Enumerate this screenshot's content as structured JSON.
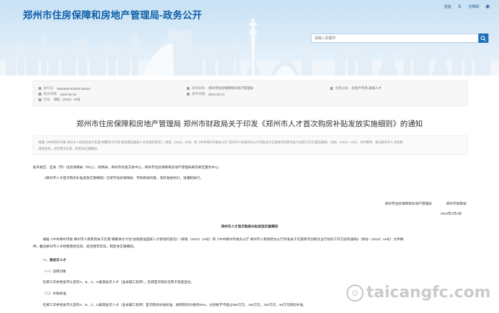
{
  "header": {
    "site_title": "郑州市住房保障和房地产管理局-政务公开",
    "links": [
      "智能",
      "无障碍"
    ],
    "search_placeholder": "请输入关键字"
  },
  "meta": {
    "row1": [
      {
        "label": "索引号:",
        "value": "0062929-6/2024-00019"
      },
      {
        "label": "发布机构:",
        "value": "郑州市住房保障和房地产管理局"
      },
      {
        "label": "主题分类:",
        "value": "房地产市场,高端人才"
      }
    ],
    "row2": [
      {
        "label": "成文日期:",
        "value": "2024-02-04"
      },
      {
        "label": "发布日期:",
        "value": "2024-02-21"
      }
    ],
    "row3": [
      {
        "label": "文号:",
        "value": "郑房〔2024〕23号"
      }
    ]
  },
  "doc_title": "郑州市住房保障和房地产管理局 郑州市财政局关于印发《郑州市人才首次购房补贴发放实施细则》的通知",
  "abstract": {
    "line1": "根据《中共郑州市委 郑州市人民政府关于实施“郑聚英才计划”加快建设国家人才高地的意见》（郑发〔2023〕19号）和《中共郑州市委办公厅 郑州市人民政府办公厅印发关于实施青年创新创业行动的工作方案的通知》（郑办〔2022〕18号）文件精神，推动郑州市人才政策",
    "line2": "落地见效，结合我市实际，制定本实施细则。"
  },
  "body": {
    "recipients": "各开发区、区县（市）住房保障局（中心），财政局，郑州市房屋交易中心，郑州市住房保障和房地产管理局郑东新区服务中心：",
    "intro": "《郑州市人才首次购房补贴发放实施细则》已经市住房保障局、市财政局同意，现印发给你们，请遵照执行。",
    "sign_org1": "郑州市住房保障和房地产管理局",
    "sign_org2": "郑州市财政局",
    "sign_date": "2024年2月4日",
    "section_title": "郑州市人才首次购房补贴发放实施细则",
    "para1": "根据《中共郑州市委 郑州市人民政府关于实施“郑聚英才计划”加快建设国家人才高地的意见》（郑发〔2023〕19号）和《中共郑州市委办公厅 郑州市人民政府办公厅印发关于实施青年创新创业行动的工作方案的通知》（郑办〔2022〕18号）文件精",
    "para1b": "神，推动郑州市人才政策落地见效，结合我市实际，制定本实施细则。",
    "h1": "一、高层次人才",
    "h1_1": "（一）适用对象",
    "p1_1": "在郑工作并经省市认定的A、B、C、D类高层次人才（含卓越工程师），在郑首次购房且用于家庭自住。",
    "h1_2": "（二）补贴标准",
    "p1_2": "在郑工作并经省市认定的A、B、C、D类高层次人才（含卓越工程师）首次购房补贴标准：按照购房价格的50%，分别给予不超过300万元、150万元、100万元、50万元购房补贴。"
  },
  "watermark": "taicangfc.com"
}
